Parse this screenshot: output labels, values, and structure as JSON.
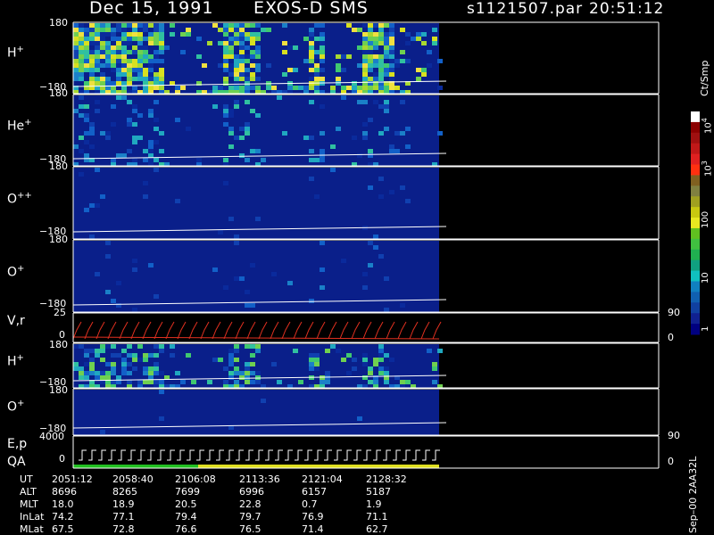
{
  "header": {
    "date": "Dec 15, 1991",
    "instrument": "EXOS-D SMS",
    "file": "s1121507.par",
    "time": "20:51:12"
  },
  "chart_data": {
    "type": "heatmap",
    "panels": [
      {
        "label": "H",
        "sup": "+",
        "ytop": "180",
        "ybot": "−180",
        "intensity": 0.9
      },
      {
        "label": "He",
        "sup": "+",
        "ytop": "180",
        "ybot": "−180",
        "intensity": 0.25
      },
      {
        "label": "O",
        "sup": "++",
        "ytop": "180",
        "ybot": "−180",
        "intensity": 0.05
      },
      {
        "label": "O",
        "sup": "+",
        "ytop": "180",
        "ybot": "−180",
        "intensity": 0.05
      },
      {
        "label": "V,r",
        "sup": "",
        "ytop": "25",
        "ybot": "0",
        "right_top": "90",
        "right_bot": "0"
      },
      {
        "label": "H",
        "sup": "+",
        "ytop": "180",
        "ybot": "−180",
        "intensity": 0.45
      },
      {
        "label": "O",
        "sup": "+",
        "ytop": "180",
        "ybot": "−180",
        "intensity": 0.03
      },
      {
        "label": "E,p",
        "sup": "",
        "label2": "QA",
        "ytop": "4000",
        "ybot": "0",
        "right_top": "90",
        "right_bot": "0"
      }
    ],
    "colorbar": {
      "unit": "Ct/Smp",
      "ticks": [
        {
          "label": "1",
          "sup": ""
        },
        {
          "label": "10",
          "sup": ""
        },
        {
          "label": "100",
          "sup": ""
        },
        {
          "label": "10",
          "sup": "3"
        },
        {
          "label": "10",
          "sup": "4"
        }
      ]
    },
    "x_axis": {
      "rows": [
        {
          "name": "UT",
          "values": [
            "2051:12",
            "2058:40",
            "2106:08",
            "2113:36",
            "2121:04",
            "2128:32"
          ]
        },
        {
          "name": "ALT",
          "values": [
            "8696",
            "8265",
            "7699",
            "6996",
            "6157",
            "5187"
          ]
        },
        {
          "name": "MLT",
          "values": [
            "18.0",
            "18.9",
            "20.5",
            "22.8",
            "0.7",
            "1.9"
          ]
        },
        {
          "name": "InLat",
          "values": [
            "74.2",
            "77.1",
            "79.4",
            "79.7",
            "76.9",
            "71.1"
          ]
        },
        {
          "name": "MLat",
          "values": [
            "67.5",
            "72.8",
            "76.6",
            "76.5",
            "71.4",
            "62.7"
          ]
        }
      ]
    },
    "footer_note": "Sep–00 2AA32L"
  }
}
